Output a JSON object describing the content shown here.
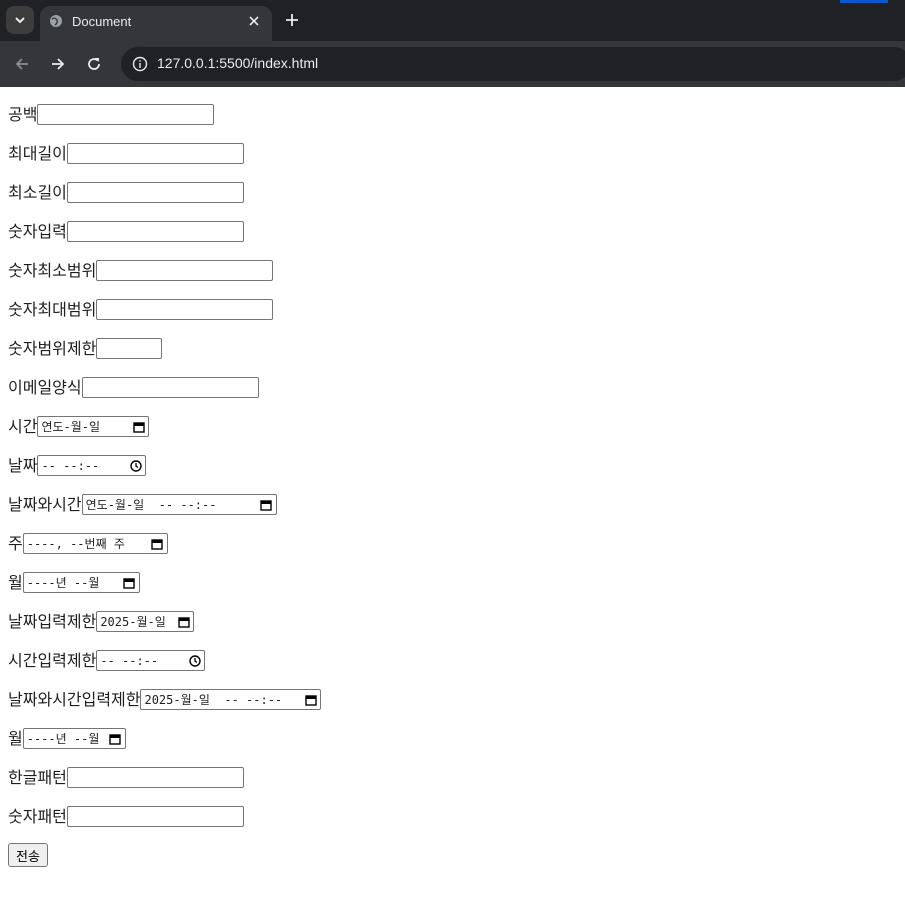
{
  "browser": {
    "tab_title": "Document",
    "url": "127.0.0.1:5500/index.html",
    "colors": {
      "frame": "#202124",
      "toolbar": "#35363a",
      "accent": "#0b57d0"
    }
  },
  "form": {
    "fields": [
      {
        "label": "공백",
        "type": "text",
        "value": ""
      },
      {
        "label": "최대길이",
        "type": "text",
        "value": ""
      },
      {
        "label": "최소길이",
        "type": "text",
        "value": ""
      },
      {
        "label": "숫자입력",
        "type": "text",
        "value": ""
      },
      {
        "label": "숫자최소범위",
        "type": "text",
        "value": ""
      },
      {
        "label": "숫자최대범위",
        "type": "text",
        "value": ""
      },
      {
        "label": "숫자범위제한",
        "type": "number",
        "value": ""
      },
      {
        "label": "이메일양식",
        "type": "email",
        "value": ""
      },
      {
        "label": "시간",
        "type": "date",
        "display": "연도-월-일"
      },
      {
        "label": "날짜",
        "type": "time",
        "display": "-- --:--"
      },
      {
        "label": "날짜와시간",
        "type": "datetime-local",
        "display": "연도-월-일  -- --:--"
      },
      {
        "label": "주",
        "type": "week",
        "display": "----, --번째 주"
      },
      {
        "label": "월",
        "type": "month",
        "display": "----년 --월"
      },
      {
        "label": "날짜입력제한",
        "type": "date",
        "display": "2025-월-일"
      },
      {
        "label": "시간입력제한",
        "type": "time",
        "display": "-- --:--"
      },
      {
        "label": "날짜와시간입력제한",
        "type": "datetime-local",
        "display": "2025-월-일  -- --:--"
      },
      {
        "label": "월",
        "type": "month",
        "display": "----년 --월"
      },
      {
        "label": "한글패턴",
        "type": "text",
        "value": ""
      },
      {
        "label": "숫자패턴",
        "type": "text",
        "value": ""
      }
    ],
    "submit_label": "전송"
  }
}
